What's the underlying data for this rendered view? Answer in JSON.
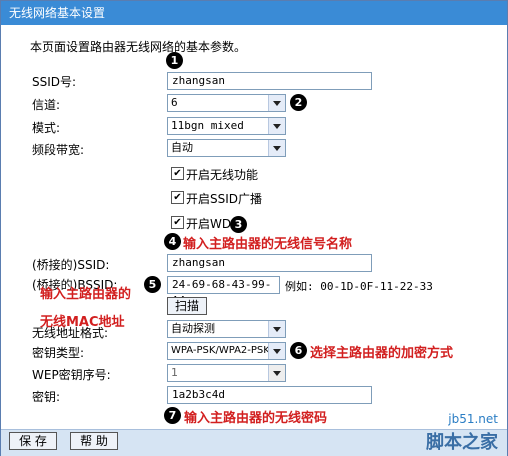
{
  "window": {
    "title": "无线网络基本设置"
  },
  "description": "本页面设置路由器无线网络的基本参数。",
  "form": {
    "ssid": {
      "label": "SSID号:",
      "value": "zhangsan"
    },
    "channel": {
      "label": "信道:",
      "value": "6"
    },
    "mode": {
      "label": "模式:",
      "value": "11bgn mixed"
    },
    "bandwidth": {
      "label": "频段带宽:",
      "value": "自动"
    },
    "enable_wireless": {
      "label": "开启无线功能",
      "checked": true
    },
    "enable_ssid_broadcast": {
      "label": "开启SSID广播",
      "checked": true
    },
    "enable_wds": {
      "label": "开启WDS",
      "checked": true
    },
    "bridged_ssid": {
      "label": "(桥接的)SSID:",
      "value": "zhangsan"
    },
    "bridged_bssid": {
      "label": "(桥接的)BSSID:",
      "value": "24-69-68-43-99-A4",
      "example": "例如: 00-1D-0F-11-22-33"
    },
    "scan_button": "扫描",
    "address_format": {
      "label": "无线地址格式:",
      "value": "自动探测"
    },
    "key_type": {
      "label": "密钥类型:",
      "value": "WPA-PSK/WPA2-PSK"
    },
    "wep_key_index": {
      "label": "WEP密钥序号:",
      "value": "1"
    },
    "key": {
      "label": "密钥:",
      "value": "1a2b3c4d"
    }
  },
  "annotations": {
    "n1": "1",
    "n2": "2",
    "n3": "3",
    "n4": "4",
    "n5": "5",
    "n6": "6",
    "n7": "7",
    "note4": "输入主路由器的无线信号名称",
    "note5a": "输入主路由器的",
    "note5b": "无线MAC地址",
    "note6": "选择主路由器的加密方式",
    "note7": "输入主路由器的无线密码"
  },
  "buttons": {
    "save": "保 存",
    "help": "帮 助"
  },
  "watermark": {
    "line1": "jb51.net",
    "line2": "脚本之家"
  },
  "colors": {
    "title_bar": "#3a8bd6",
    "annotation_red": "#d21f1f",
    "bottom_bar": "#d6e4f3"
  }
}
